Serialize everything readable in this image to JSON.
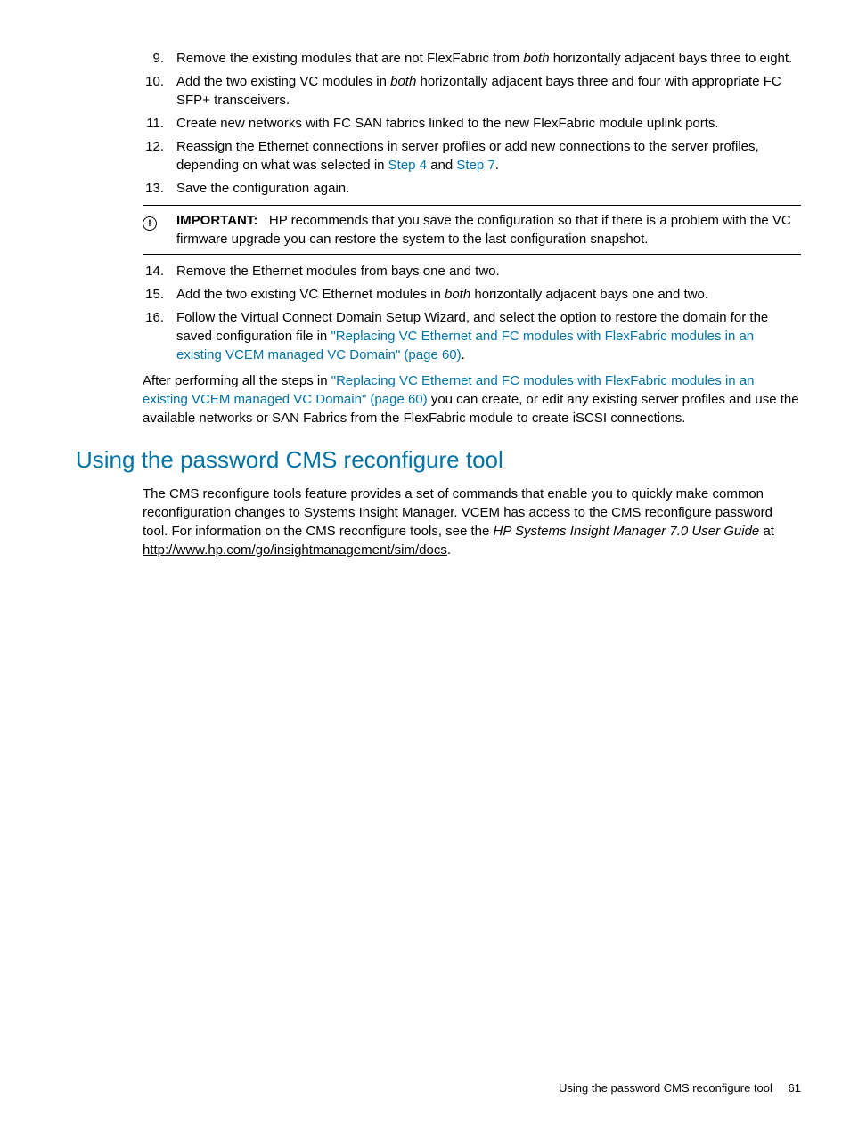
{
  "steps1": [
    {
      "n": "9.",
      "pre": "Remove the existing modules that are not FlexFabric from ",
      "ital": "both",
      "post": " horizontally adjacent bays three to eight."
    },
    {
      "n": "10.",
      "pre": "Add the two existing VC modules in ",
      "ital": "both",
      "post": " horizontally adjacent bays three and four with appropriate FC SFP+ transceivers."
    },
    {
      "n": "11.",
      "pre": "Create new networks with FC SAN fabrics linked to the new FlexFabric module uplink ports.",
      "ital": "",
      "post": ""
    }
  ],
  "step12": {
    "n": "12.",
    "t1": "Reassign the Ethernet connections in server profiles or add new connections to the server profiles, depending on what was selected in ",
    "link1": "Step 4",
    "t2": " and ",
    "link2": "Step 7",
    "t3": "."
  },
  "step13": {
    "n": "13.",
    "t": "Save the configuration again."
  },
  "important": {
    "label": "IMPORTANT:",
    "text": "HP recommends that you save the configuration so that if there is a problem with the VC firmware upgrade you can restore the system to the last configuration snapshot."
  },
  "step14": {
    "n": "14.",
    "t": "Remove the Ethernet modules from bays one and two."
  },
  "step15": {
    "n": "15.",
    "pre": "Add the two existing VC Ethernet modules in ",
    "ital": "both",
    "post": " horizontally adjacent bays one and two."
  },
  "step16": {
    "n": "16.",
    "t1": "Follow the Virtual Connect Domain Setup Wizard, and select the option to restore the domain for the saved configuration file in ",
    "link": "\"Replacing VC Ethernet and FC modules with FlexFabric modules in an existing VCEM managed VC Domain\" (page 60)",
    "t2": "."
  },
  "afterPara": {
    "t1": "After performing all the steps in ",
    "link": "\"Replacing VC Ethernet and FC modules with FlexFabric modules in an existing VCEM managed VC Domain\" (page 60)",
    "t2": " you can create, or edit any existing server profiles and use the available networks or SAN Fabrics from the FlexFabric module to create iSCSI connections."
  },
  "heading": "Using the password CMS reconfigure tool",
  "cmsPara": {
    "t1": "The CMS reconfigure tools feature provides a set of commands that enable you to quickly make common reconfiguration changes to Systems Insight Manager. VCEM has access to the CMS reconfigure password tool. For information on the CMS reconfigure tools, see the ",
    "ital": "HP Systems Insight Manager 7.0 User Guide",
    "t2": " at ",
    "url": "http://www.hp.com/go/insightmanagement/sim/docs",
    "t3": "."
  },
  "footer": {
    "text": "Using the password CMS reconfigure tool",
    "page": "61"
  },
  "iconGlyph": "!"
}
